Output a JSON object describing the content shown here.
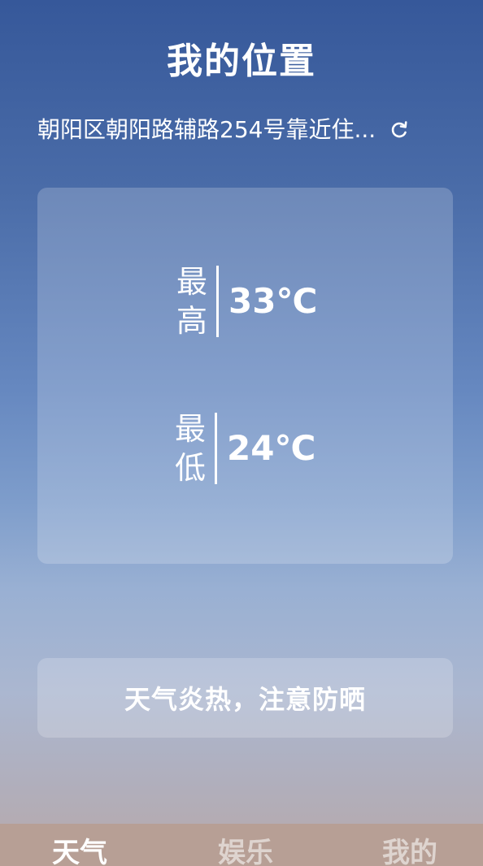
{
  "header": {
    "title": "我的位置",
    "location": "朝阳区朝阳路辅路254号靠近住...",
    "refresh_icon": "refresh-icon"
  },
  "temperature": {
    "high_label": "最高",
    "high_value": "33℃",
    "low_label": "最低",
    "low_value": "24℃"
  },
  "tip": {
    "text": "天气炎热，注意防晒"
  },
  "nav": {
    "weather": "天气",
    "fun": "娱乐",
    "mine": "我的",
    "active": "天气"
  },
  "colors": {
    "background_top": "#36589a",
    "background_bottom": "#b8a9a9",
    "nav_background": "#b79f95",
    "text": "#ffffff"
  }
}
